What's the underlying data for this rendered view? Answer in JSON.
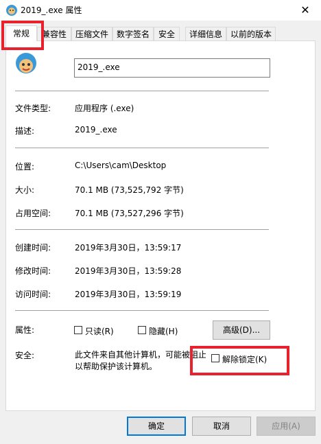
{
  "window": {
    "title": "2019_.exe 属性",
    "close_glyph": "✕"
  },
  "tabs": [
    {
      "label": "常规"
    },
    {
      "label": "兼容性"
    },
    {
      "label": "压缩文件"
    },
    {
      "label": "数字签名"
    },
    {
      "label": "安全"
    },
    {
      "label": "详细信息"
    },
    {
      "label": "以前的版本"
    }
  ],
  "general": {
    "file_name": "2019_.exe",
    "type_label": "文件类型:",
    "type_value": "应用程序 (.exe)",
    "desc_label": "描述:",
    "desc_value": "2019_.exe",
    "location_label": "位置:",
    "location_value": "C:\\Users\\cam\\Desktop",
    "size_label": "大小:",
    "size_value": "70.1 MB (73,525,792 字节)",
    "disk_label": "占用空间:",
    "disk_value": "70.1 MB (73,527,296 字节)",
    "created_label": "创建时间:",
    "created_value": "2019年3月30日，13:59:17",
    "modified_label": "修改时间:",
    "modified_value": "2019年3月30日，13:59:28",
    "accessed_label": "访问时间:",
    "accessed_value": "2019年3月30日，13:59:19",
    "attr_label": "属性:",
    "readonly_label": "只读(R)",
    "hidden_label": "隐藏(H)",
    "advanced_label": "高级(D)...",
    "security_label": "安全:",
    "security_line1": "此文件来自其他计算机，可能被阻止",
    "security_line2": "以帮助保护该计算机。",
    "unblock_label": "解除锁定(K)"
  },
  "footer": {
    "ok": "确定",
    "cancel": "取消",
    "apply": "应用(A)"
  },
  "colors": {
    "annotation": "#e8212d",
    "accent": "#0078d7"
  }
}
